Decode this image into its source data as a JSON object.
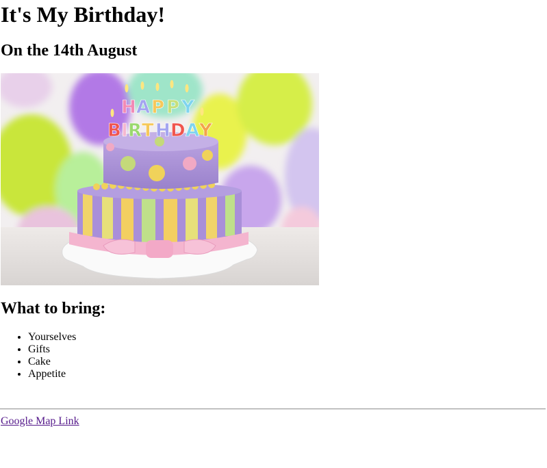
{
  "heading": "It's My Birthday!",
  "date": "On the 14th August",
  "image": {
    "cake_letters": "HAPPY BIRTHDAY"
  },
  "bring": {
    "title": "What to bring:",
    "items": [
      "Yourselves",
      "Gifts",
      "Cake",
      "Appetite"
    ]
  },
  "link": {
    "label": "Google Map Link",
    "color": "#551a8b"
  }
}
